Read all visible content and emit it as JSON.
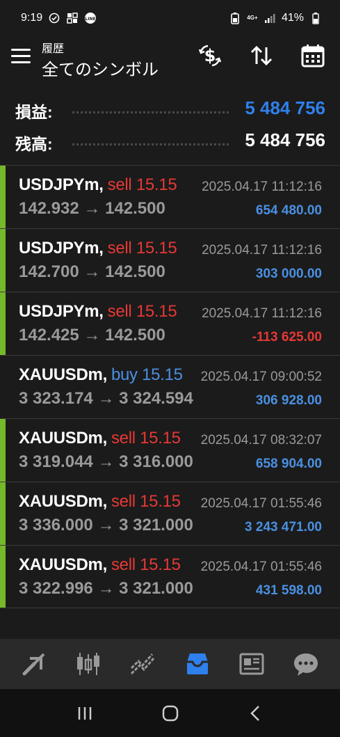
{
  "status_bar": {
    "time": "9:19",
    "network": "4G+",
    "battery": "41%"
  },
  "header": {
    "subtitle": "履歴",
    "title": "全てのシンボル",
    "icons": [
      "menu-icon",
      "dollar-exchange-icon",
      "sort-icon",
      "calendar-icon"
    ]
  },
  "summary": {
    "profit_label": "損益:",
    "profit_value": "5 484 756",
    "balance_label": "残高:",
    "balance_value": "5 484 756"
  },
  "colors": {
    "sell": "#e53935",
    "buy": "#4a90e2",
    "profit_positive": "#4a90e2",
    "profit_negative": "#e53935",
    "accent_bar": "#76b82a",
    "active_nav": "#4a90e2"
  },
  "deals": [
    {
      "symbol": "USDJPYm,",
      "side": "sell 15.15",
      "type": "sell",
      "time": "2025.04.17 11:12:16",
      "prices": "142.932 → 142.500",
      "profit": "654 480.00",
      "negative": false,
      "bar": true
    },
    {
      "symbol": "USDJPYm,",
      "side": "sell 15.15",
      "type": "sell",
      "time": "2025.04.17 11:12:16",
      "prices": "142.700 → 142.500",
      "profit": "303 000.00",
      "negative": false,
      "bar": true
    },
    {
      "symbol": "USDJPYm,",
      "side": "sell 15.15",
      "type": "sell",
      "time": "2025.04.17 11:12:16",
      "prices": "142.425 → 142.500",
      "profit": "-113 625.00",
      "negative": true,
      "bar": true
    },
    {
      "symbol": "XAUUSDm,",
      "side": "buy 15.15",
      "type": "buy",
      "time": "2025.04.17 09:00:52",
      "prices": "3 323.174 → 3 324.594",
      "profit": "306 928.00",
      "negative": false,
      "bar": false
    },
    {
      "symbol": "XAUUSDm,",
      "side": "sell 15.15",
      "type": "sell",
      "time": "2025.04.17 08:32:07",
      "prices": "3 319.044 → 3 316.000",
      "profit": "658 904.00",
      "negative": false,
      "bar": true
    },
    {
      "symbol": "XAUUSDm,",
      "side": "sell 15.15",
      "type": "sell",
      "time": "2025.04.17 01:55:46",
      "prices": "3 336.000 → 3 321.000",
      "profit": "3 243 471.00",
      "negative": false,
      "bar": true
    },
    {
      "symbol": "XAUUSDm,",
      "side": "sell 15.15",
      "type": "sell",
      "time": "2025.04.17 01:55:46",
      "prices": "3 322.996 → 3 321.000",
      "profit": "431 598.00",
      "negative": false,
      "bar": true
    }
  ],
  "bottom_nav": {
    "items": [
      "quotes-icon",
      "chart-icon",
      "trade-icon",
      "history-icon",
      "news-icon",
      "messages-icon"
    ],
    "active": "history-icon"
  },
  "system_nav": [
    "recents-button",
    "home-button",
    "back-button"
  ]
}
